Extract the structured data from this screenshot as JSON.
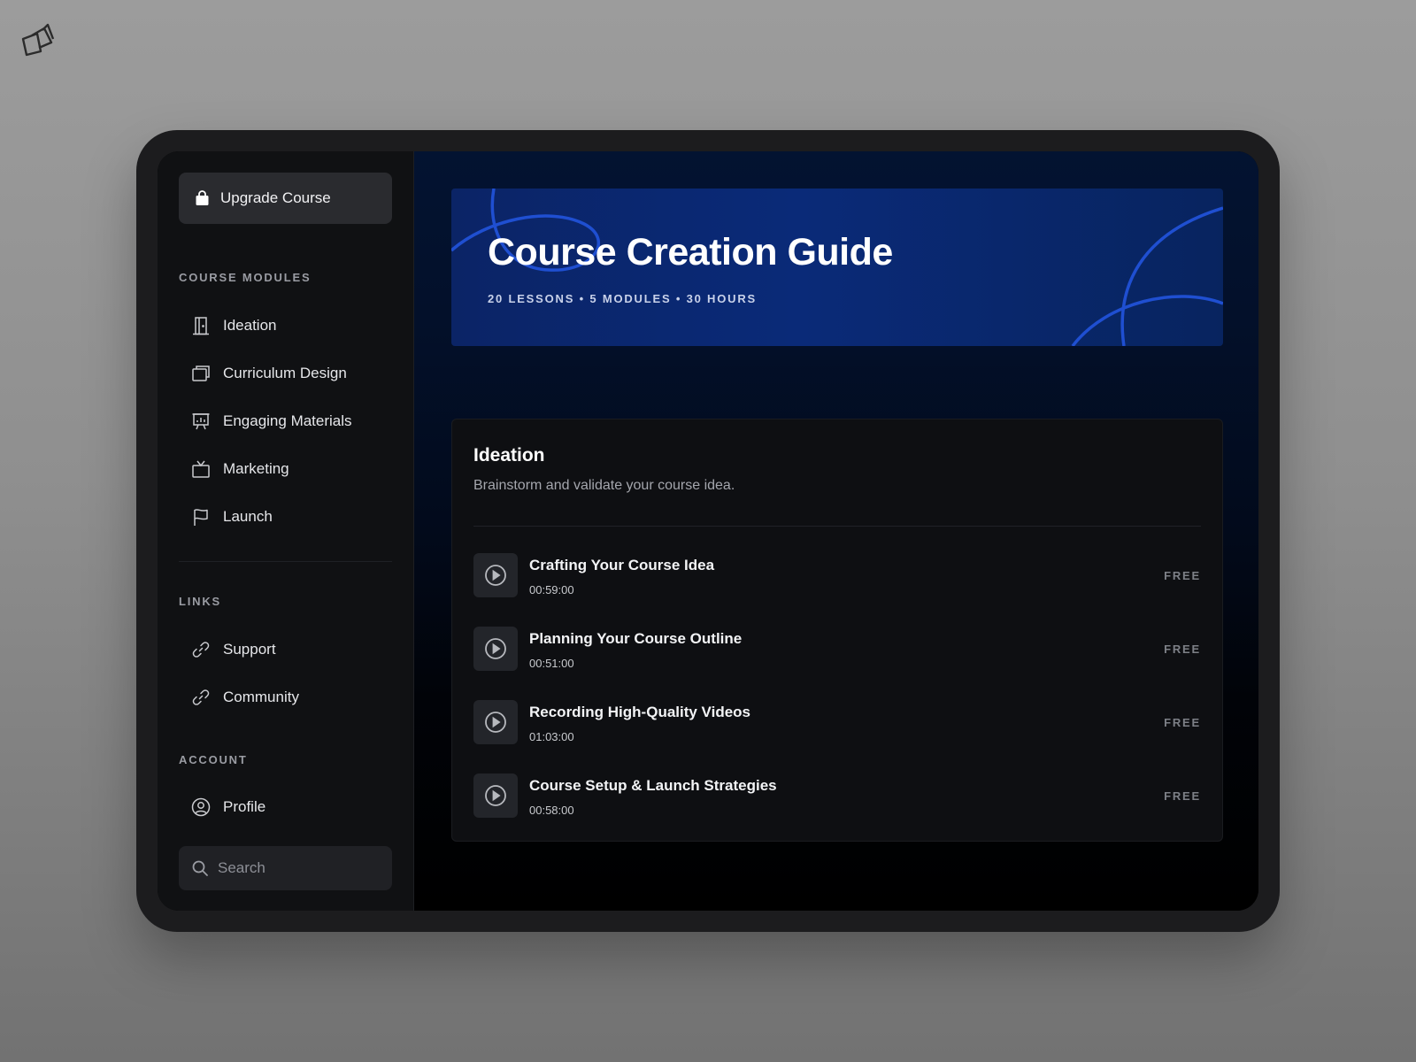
{
  "brand": {
    "logo_icon": "stacked-squares-logo-icon"
  },
  "sidebar": {
    "upgrade_label": "Upgrade Course",
    "sections": {
      "modules_title": "COURSE MODULES",
      "links_title": "LINKS",
      "account_title": "ACCOUNT"
    },
    "modules": [
      {
        "label": "Ideation",
        "icon": "door-icon"
      },
      {
        "label": "Curriculum Design",
        "icon": "layers-icon"
      },
      {
        "label": "Engaging Materials",
        "icon": "presentation-icon"
      },
      {
        "label": "Marketing",
        "icon": "tv-icon"
      },
      {
        "label": "Launch",
        "icon": "flag-icon"
      }
    ],
    "links": [
      {
        "label": "Support",
        "icon": "link-icon"
      },
      {
        "label": "Community",
        "icon": "link-icon"
      }
    ],
    "account": [
      {
        "label": "Profile",
        "icon": "user-circle-icon"
      }
    ],
    "search": {
      "placeholder": "Search"
    }
  },
  "banner": {
    "title": "Course Creation Guide",
    "meta": "20 LESSONS • 5 MODULES • 30 HOURS"
  },
  "module": {
    "title": "Ideation",
    "description": "Brainstorm and validate your course idea.",
    "lessons": [
      {
        "title": "Crafting Your Course Idea",
        "duration": "00:59:00",
        "badge": "FREE"
      },
      {
        "title": "Planning Your Course Outline",
        "duration": "00:51:00",
        "badge": "FREE"
      },
      {
        "title": "Recording High-Quality Videos",
        "duration": "01:03:00",
        "badge": "FREE"
      },
      {
        "title": "Course Setup & Launch Strategies",
        "duration": "00:58:00",
        "badge": "FREE"
      }
    ]
  },
  "colors": {
    "page_bg": "#939393",
    "device_frame": "#1c1c1e",
    "sidebar_bg": "#101113",
    "banner_blue": "#0a2a78",
    "accent_line": "#1f4fd1"
  }
}
